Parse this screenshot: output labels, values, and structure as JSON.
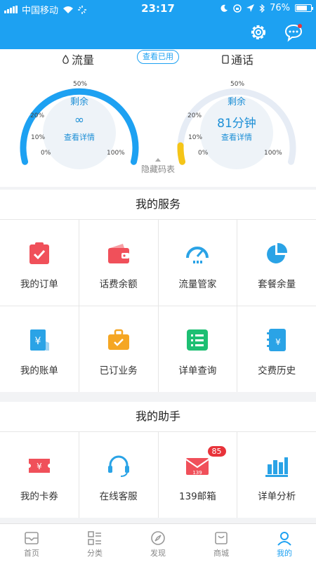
{
  "status_bar": {
    "carrier": "中国移动",
    "time": "23:17",
    "battery": "76%",
    "battery_level": 0.76
  },
  "usage": {
    "data_tab": "流量",
    "call_tab": "通话",
    "view_used": "查看已用",
    "data_gauge": {
      "remaining_label": "剩余",
      "value": "∞",
      "detail": "查看详情",
      "fill": 1.0
    },
    "call_gauge": {
      "remaining_label": "剩余",
      "value": "81分钟",
      "detail": "查看详情",
      "fill": 0.08
    },
    "scale": {
      "p0": "0%",
      "p10": "10%",
      "p20": "20%",
      "p50": "50%",
      "p100": "100%"
    },
    "hide_code": "隐藏码表"
  },
  "services": {
    "title": "我的服务",
    "items": [
      {
        "label": "我的订单",
        "icon": "clipboard-check-icon",
        "color": "#f0505a"
      },
      {
        "label": "话费余额",
        "icon": "wallet-icon",
        "color": "#f0505a"
      },
      {
        "label": "流量管家",
        "icon": "speedometer-icon",
        "color": "#2aa3e6"
      },
      {
        "label": "套餐余量",
        "icon": "pie-chart-icon",
        "color": "#2aa3e6"
      },
      {
        "label": "我的账单",
        "icon": "bill-icon",
        "color": "#2aa3e6"
      },
      {
        "label": "已订业务",
        "icon": "briefcase-icon",
        "color": "#f5a623"
      },
      {
        "label": "详单查询",
        "icon": "list-icon",
        "color": "#1dbf73"
      },
      {
        "label": "交费历史",
        "icon": "notebook-icon",
        "color": "#2aa3e6"
      }
    ]
  },
  "assistant": {
    "title": "我的助手",
    "items": [
      {
        "label": "我的卡券",
        "icon": "coupon-icon",
        "color": "#f0505a"
      },
      {
        "label": "在线客服",
        "icon": "headset-icon",
        "color": "#2aa3e6"
      },
      {
        "label": "139邮箱",
        "icon": "mail-icon",
        "color": "#f0505a",
        "badge": "85",
        "icon_text": "139"
      },
      {
        "label": "详单分析",
        "icon": "bar-chart-icon",
        "color": "#2aa3e6"
      }
    ]
  },
  "tabbar": {
    "items": [
      {
        "label": "首页",
        "icon": "home-icon"
      },
      {
        "label": "分类",
        "icon": "category-icon"
      },
      {
        "label": "发现",
        "icon": "compass-icon"
      },
      {
        "label": "商城",
        "icon": "bag-icon"
      },
      {
        "label": "我的",
        "icon": "profile-icon",
        "active": true
      }
    ]
  },
  "colors": {
    "primary": "#1da1f2",
    "track": "#e6ecf5",
    "warning": "#f5c518"
  }
}
